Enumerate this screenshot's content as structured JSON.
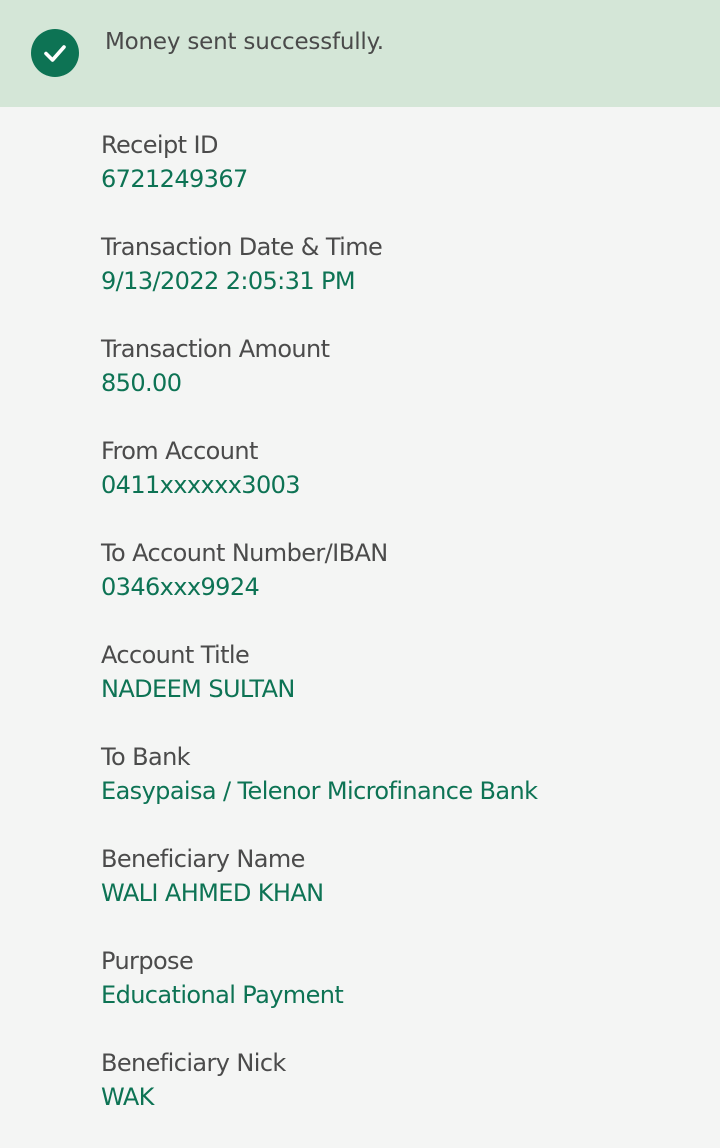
{
  "banner": {
    "icon": "check-circle-icon",
    "message": "Money sent successfully."
  },
  "colors": {
    "banner_bg": "#d4e6d7",
    "accent": "#0d7354",
    "label": "#4b4b4b",
    "background": "#f4f5f4"
  },
  "receipt": {
    "fields": [
      {
        "label": "Receipt ID",
        "value": "6721249367"
      },
      {
        "label": "Transaction Date & Time",
        "value": "9/13/2022 2:05:31 PM"
      },
      {
        "label": "Transaction Amount",
        "value": "850.00"
      },
      {
        "label": "From Account",
        "value": "0411xxxxxx3003"
      },
      {
        "label": "To Account Number/IBAN",
        "value": "0346xxx9924"
      },
      {
        "label": "Account Title",
        "value": "NADEEM SULTAN"
      },
      {
        "label": "To Bank",
        "value": "Easypaisa / Telenor Microfinance Bank"
      },
      {
        "label": "Beneficiary Name",
        "value": "WALI AHMED KHAN"
      },
      {
        "label": "Purpose",
        "value": "Educational Payment"
      },
      {
        "label": "Beneficiary Nick",
        "value": "WAK"
      }
    ]
  }
}
